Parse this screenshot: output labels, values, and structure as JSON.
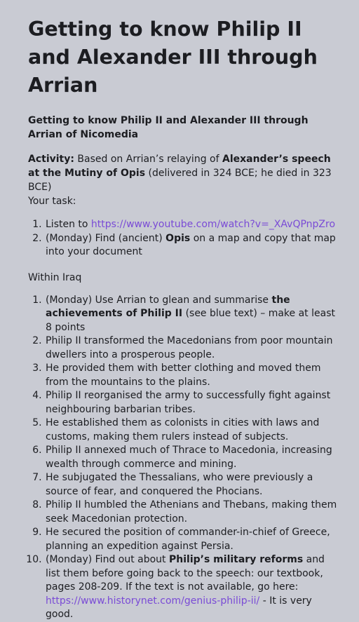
{
  "title": "Getting to know Philip II and Alexander III through Arrian",
  "subtitle": "Getting to know Philip II and Alexander III through Arrian of Nicomedia",
  "activity": {
    "label": "Activity:",
    "text1": "Based on Arrian’s relaying of",
    "bold": "Alexander’s speech at the Mutiny of Opis",
    "text2": "(delivered in 324 BCE; he died in 323 BCE)",
    "task": "Your task:"
  },
  "list1": [
    {
      "prefix": "Listen to",
      "link": "https://www.youtube.com/watch?v=_XAvQPnpZro"
    },
    {
      "pre": "(Monday) Find (ancient)",
      "bold": "Opis",
      "post": "on a map and copy that map into your document"
    }
  ],
  "within": "Within Iraq",
  "list2_first": {
    "pre": "(Monday) Use Arrian to glean and summarise",
    "bold": "the achievements of Philip II",
    "post": "(see blue text) – make at least 8 points"
  },
  "list2_points": [
    "Philip II transformed the Macedonians from poor mountain dwellers into a prosperous people.",
    "He provided them with better clothing and moved them from the mountains to the plains.",
    "Philip II reorganised the army to successfully fight against neighbouring barbarian tribes.",
    "He established them as colonists in cities with laws and customs, making them rulers instead of subjects.",
    "Philip II annexed much of Thrace to Macedonia, increasing wealth through commerce and mining.",
    "He subjugated the Thessalians, who were previously a source of fear, and conquered the Phocians.",
    "Philip II humbled the Athenians and Thebans, making them seek Macedonian protection.",
    "He secured the position of commander-in-chief of Greece, planning an expedition against Persia."
  ],
  "list2_last": {
    "pre": "(Monday) Find out about",
    "bold": "Philip’s military reforms",
    "post": "and list them before going back to the speech: our textbook, pages 208-209. If the text is not available, go here:",
    "link": "https://www.historynet.com/genius-philip-ii/",
    "tail": "- It is very good."
  }
}
